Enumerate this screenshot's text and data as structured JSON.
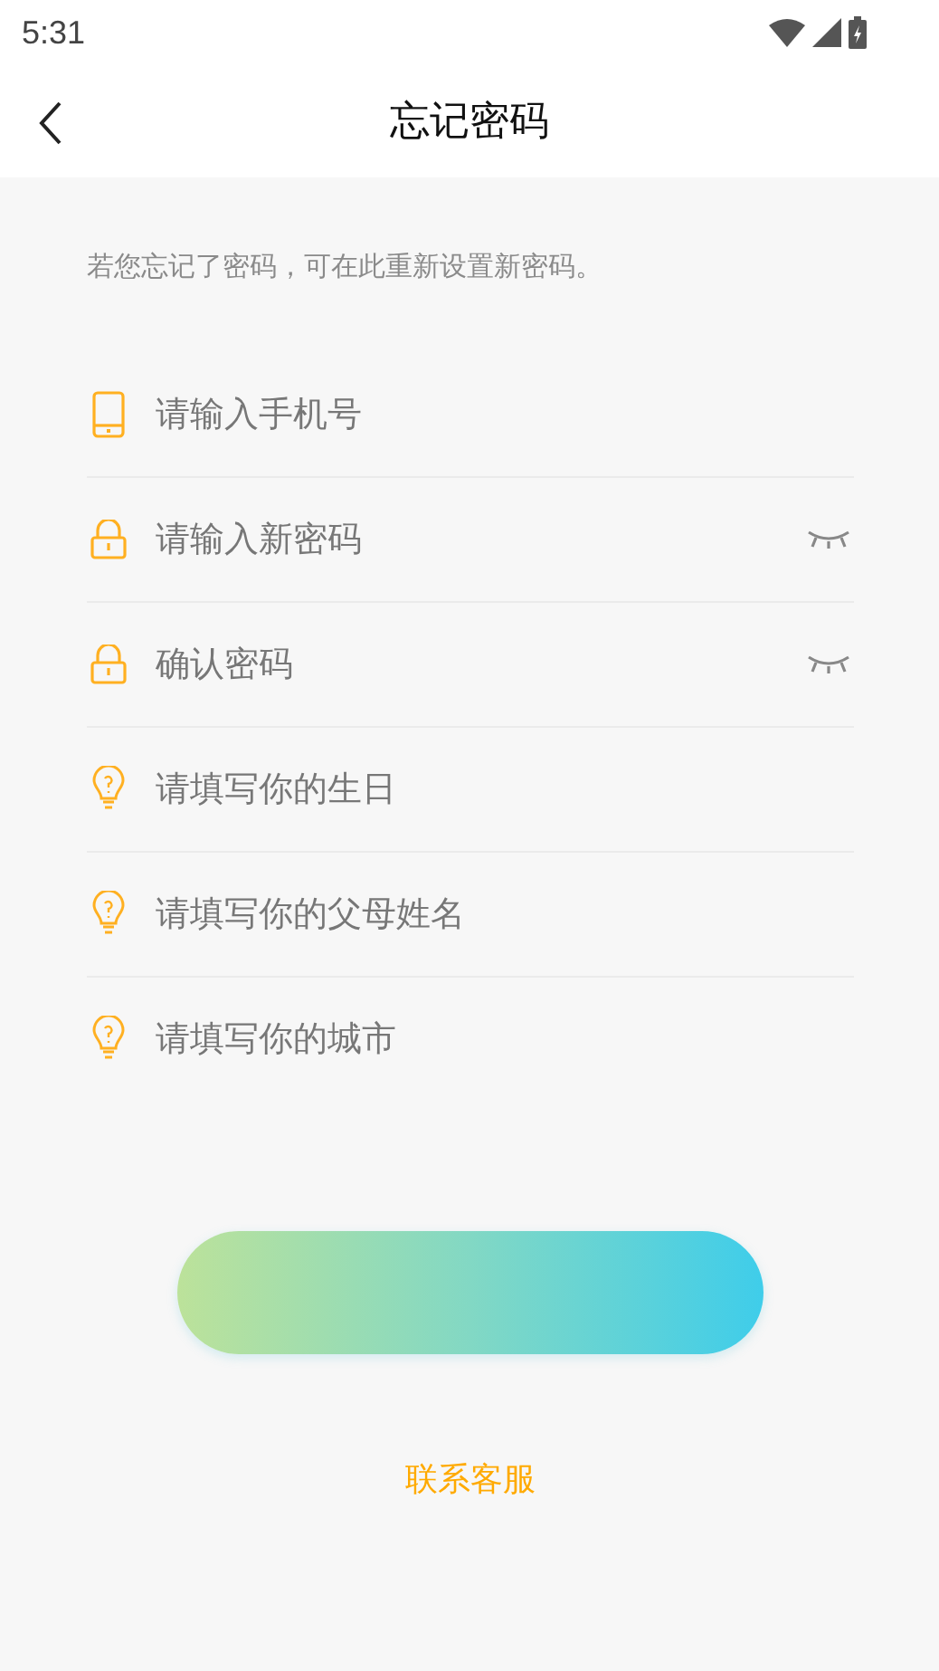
{
  "status_bar": {
    "time": "5:31"
  },
  "header": {
    "title": "忘记密码"
  },
  "intro": "若您忘记了密码，可在此重新设置新密码。",
  "fields": [
    {
      "kind": "phone",
      "placeholder": "请输入手机号"
    },
    {
      "kind": "password",
      "placeholder": "请输入新密码"
    },
    {
      "kind": "password",
      "placeholder": "确认密码"
    },
    {
      "kind": "question",
      "placeholder": "请填写你的生日"
    },
    {
      "kind": "question",
      "placeholder": "请填写你的父母姓名"
    },
    {
      "kind": "question",
      "placeholder": "请填写你的城市"
    }
  ],
  "contact_link": "联系客服"
}
